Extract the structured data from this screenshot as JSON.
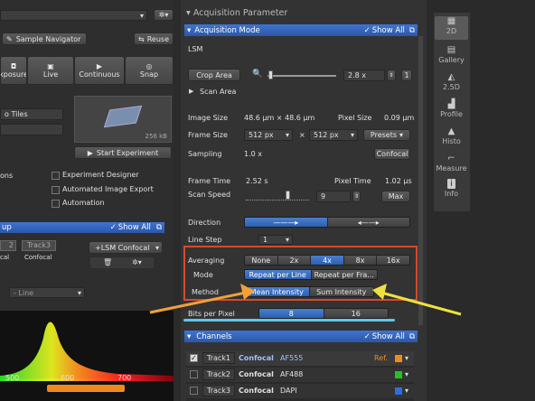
{
  "left": {
    "sample_navigator_label": "Sample Navigator",
    "reuse_label": "Reuse",
    "toolbar": [
      "xposure",
      "Live",
      "Continuous",
      "Snap"
    ],
    "tiles_label": "o Tiles",
    "file_size": "256 kB",
    "start_experiment_label": "Start Experiment",
    "options_label": "ons",
    "checkboxes": [
      "Experiment Designer",
      "Automated Image Export",
      "Automation"
    ],
    "setup_title": "up",
    "show_all_label": "Show All",
    "tracks": [
      {
        "name": "2",
        "sub": "cal"
      },
      {
        "name": "Track3",
        "sub": "Confocal"
      }
    ],
    "lsm_confocal_label": "+LSM Confocal",
    "line_select": "- Line",
    "axis_ticks": [
      "500",
      "600",
      "700"
    ]
  },
  "mid": {
    "section_title": "Acquisition Parameter",
    "acq_mode_title": "Acquisition Mode",
    "show_all_label": "Show All",
    "lsm_label": "LSM",
    "crop_area_label": "Crop Area",
    "zoom_value": "2.8 x",
    "scan_area_label": "Scan Area",
    "image_size_label": "Image Size",
    "image_size_value": "48.6 µm × 48.6 µm",
    "pixel_size_label": "Pixel Size",
    "pixel_size_value": "0.09 µm",
    "frame_size_label": "Frame Size",
    "frame_w": "512 px",
    "frame_x": "×",
    "frame_h": "512 px",
    "presets_label": "Presets",
    "sampling_label": "Sampling",
    "sampling_value": "1.0 x",
    "confocal_label": "Confocal",
    "frame_time_label": "Frame Time",
    "frame_time_value": "2.52 s",
    "pixel_time_label": "Pixel Time",
    "pixel_time_value": "1.02 µs",
    "scan_speed_label": "Scan Speed",
    "scan_speed_value": "9",
    "max_label": "Max",
    "direction_label": "Direction",
    "line_step_label": "Line Step",
    "line_step_value": "1",
    "averaging_label": "Averaging",
    "averaging_options": [
      "None",
      "2x",
      "4x",
      "8x",
      "16x"
    ],
    "mode_label": "Mode",
    "mode_options": [
      "Repeat per Line",
      "Repeat per Fra..."
    ],
    "method_label": "Method",
    "method_options": [
      "Mean Intensity",
      "Sum Intensity"
    ],
    "bits_label": "Bits per Pixel",
    "bits_options": [
      "8",
      "16"
    ],
    "channels_title": "Channels",
    "ref_label": "Ref.",
    "channels": [
      {
        "track": "Track1",
        "mode": "Confocal",
        "dye": "AF555",
        "color": "#f08a1c"
      },
      {
        "track": "Track2",
        "mode": "Confocal",
        "dye": "AF488",
        "color": "#22c222"
      },
      {
        "track": "Track3",
        "mode": "Confocal",
        "dye": "DAPI",
        "color": "#2d6fe0"
      }
    ]
  },
  "right": {
    "items": [
      "2D",
      "Gallery",
      "2.5D",
      "Profile",
      "Histo",
      "Measure",
      "Info"
    ]
  },
  "colors": {
    "accent": "#2d5fae",
    "highlight_box": "#d64a2a",
    "arrow_orange": "#f2a03a",
    "arrow_yellow": "#f0e040",
    "underline_cyan": "#5ec8e8"
  }
}
